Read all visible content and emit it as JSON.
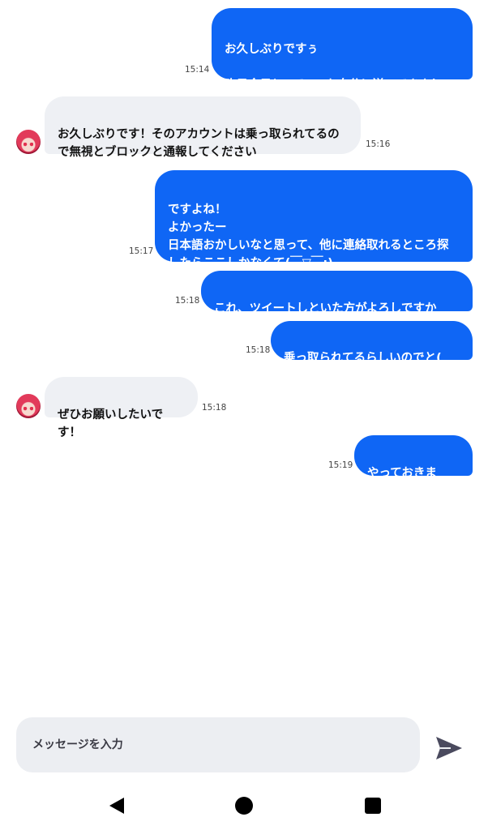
{
  "messages": [
    {
      "dir": "out",
      "text": "お久しぶりですぅ\n\n昨日今日とXでDMを自分に送ってきました？",
      "time": "15:14"
    },
    {
      "dir": "in",
      "text": "お久しぶりです！そのアカウントは乗っ取られてるので無視とブロックと通報してください",
      "time": "15:16"
    },
    {
      "dir": "out",
      "text": "ですよね！\nよかったー\n日本語おかしいなと思って、他に連絡取れるところ探したらここしかなくて(￣▽￣;)",
      "time": "15:17"
    },
    {
      "dir": "out",
      "text": "これ、ツイートしといた方がよろしですかね？",
      "time": "15:18"
    },
    {
      "dir": "out",
      "text": "乗っ取られてるらしいのでと( 'ω')",
      "time": "15:18"
    },
    {
      "dir": "in",
      "text": "ぜひお願いしたいです！",
      "time": "15:18"
    },
    {
      "dir": "out",
      "text": "やっておきます！",
      "time": "15:19"
    }
  ],
  "composer": {
    "placeholder": "メッセージを入力"
  },
  "icons": {
    "send": "send-icon",
    "avatar": "avatar",
    "back": "back-icon",
    "home": "home-icon",
    "recent": "recent-apps-icon"
  },
  "colors": {
    "outgoing_bubble": "#0f66f5",
    "incoming_bubble": "#eef0f4",
    "send_icon": "#4a4a5e"
  }
}
